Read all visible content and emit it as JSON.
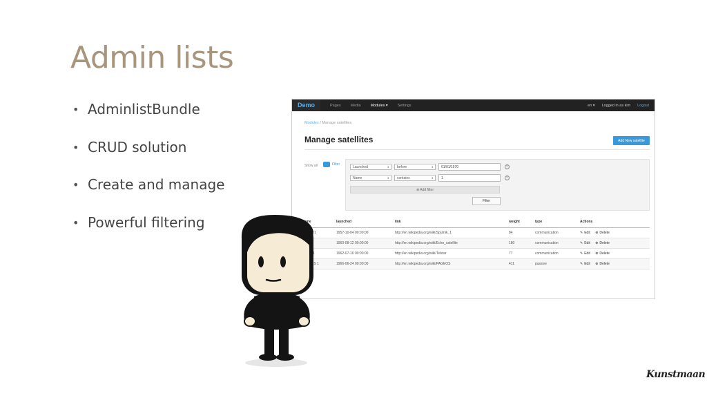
{
  "slide": {
    "title": "Admin lists",
    "bullets": [
      "AdminlistBundle",
      "CRUD solution",
      "Create and manage",
      "Powerful filtering"
    ],
    "bullet_glyph": "•",
    "logo": "Kunstmaan"
  },
  "app": {
    "brand": "Demo",
    "nav": [
      {
        "label": "Pages"
      },
      {
        "label": "Media"
      },
      {
        "label": "Modules ▾"
      },
      {
        "label": "Settings"
      }
    ],
    "lang": "en ▾",
    "user": "Logged in as kim",
    "logout": "Logout"
  },
  "breadcrumb": {
    "parent": "Modules",
    "sep": "/",
    "current": "Manage satellites"
  },
  "page_title": "Manage satellites",
  "add_button": "Add New satellite",
  "filters": {
    "show_all": "Show all",
    "toggle_label": "Filter",
    "rows": [
      {
        "field": "Launched",
        "operator": "before",
        "value": "01/01/1970"
      },
      {
        "field": "Name",
        "operator": "contains",
        "value": "1"
      }
    ],
    "add_filter": "⊕ Add filter",
    "filter_button": "Filter"
  },
  "table": {
    "headers": [
      "Name",
      "launched",
      "link",
      "weight",
      "type",
      "Actions"
    ],
    "rows": [
      [
        "Sputnik 1",
        "1957-10-04 00:00:00",
        "http://en.wikipedia.org/wiki/Sputnik_1",
        "84",
        "communication"
      ],
      [
        "Echo 1",
        "1960-08-12 00:00:00",
        "http://en.wikipedia.org/wiki/Echo_satellite",
        "180",
        "communication"
      ],
      [
        "Telstar 1",
        "1962-07-10 00:00:00",
        "http://en.wikipedia.org/wiki/Telstar",
        "77",
        "communication"
      ],
      [
        "PAGEOS 1",
        "1966-06-24 00:00:00",
        "http://en.wikipedia.org/wiki/PAGEOS",
        "411",
        "passive"
      ]
    ],
    "edit": "Edit",
    "delete": "Delete"
  },
  "colors": {
    "accent": "#3a9ad9",
    "title": "#a8957b",
    "navbar": "#222222"
  }
}
